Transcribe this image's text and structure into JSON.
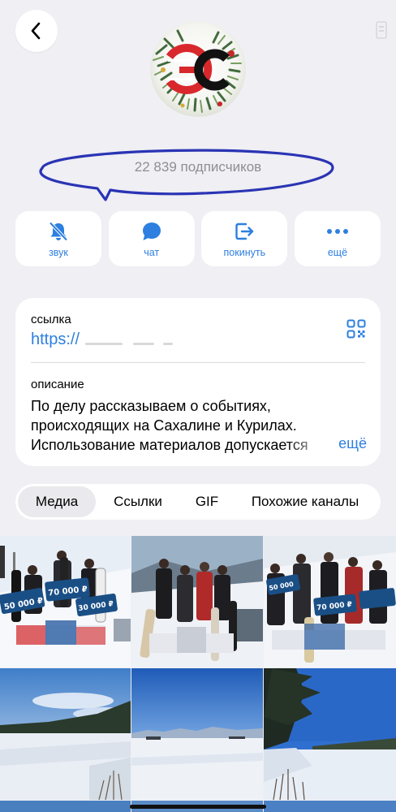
{
  "header": {
    "back_icon": "chevron-left-icon",
    "avatar_text": "ЭС",
    "subscribers": "22 839 подписчиков"
  },
  "actions": [
    {
      "label": "звук",
      "icon": "bell-slash-icon"
    },
    {
      "label": "чат",
      "icon": "chat-bubble-icon"
    },
    {
      "label": "покинуть",
      "icon": "leave-icon"
    },
    {
      "label": "ещё",
      "icon": "more-dots-icon"
    }
  ],
  "info": {
    "link_label": "ссылка",
    "link_value": "https://",
    "description_label": "описание",
    "description_lines": [
      "По делу рассказываем о событиях,",
      "происходящих на Сахалине и Курилах.",
      "Использование материалов допускается"
    ],
    "more_label": "ещё"
  },
  "tabs": [
    {
      "label": "Медиа",
      "active": true
    },
    {
      "label": "Ссылки",
      "active": false
    },
    {
      "label": "GIF",
      "active": false
    },
    {
      "label": "Похожие каналы",
      "active": false
    }
  ],
  "media": [
    {
      "kind": "podium",
      "prize_labels": [
        "50 000 ₽",
        "70 000 ₽",
        "30 000 ₽"
      ]
    },
    {
      "kind": "podium"
    },
    {
      "kind": "podium",
      "prize_labels": [
        "50 000",
        "70 000 ₽"
      ]
    },
    {
      "kind": "winter-lake"
    },
    {
      "kind": "snow-plain"
    },
    {
      "kind": "forest-shore"
    }
  ],
  "colors": {
    "accent": "#2d7fe0",
    "background": "#efeff4",
    "annotation": "#2a34b4",
    "brand_red": "#d8282c"
  }
}
